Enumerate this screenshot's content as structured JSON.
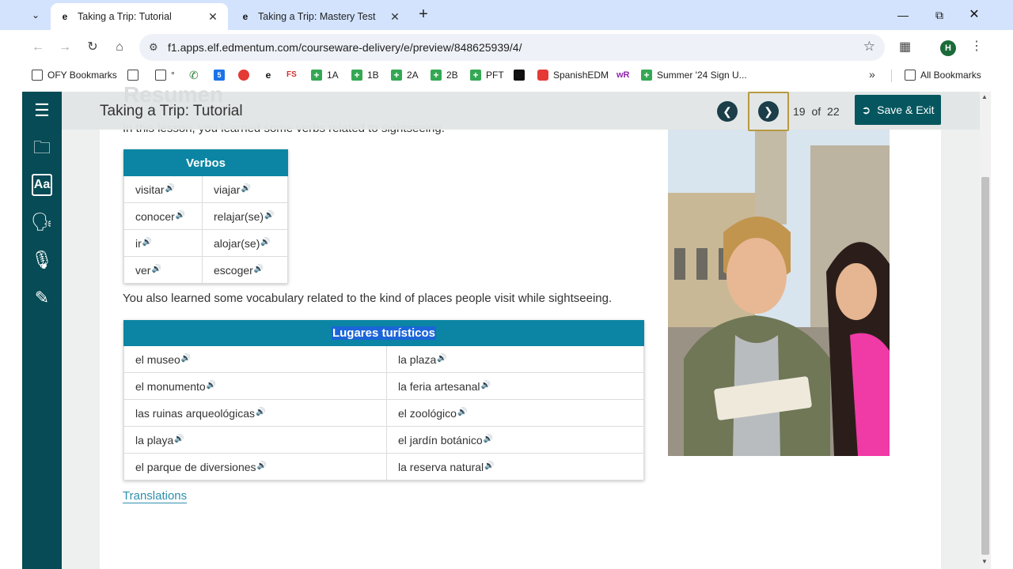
{
  "browser": {
    "tabs": [
      {
        "title": "Taking a Trip: Tutorial",
        "active": true
      },
      {
        "title": "Taking a Trip: Mastery Test",
        "active": false
      }
    ],
    "url": "f1.apps.elf.edmentum.com/courseware-delivery/e/preview/848625939/4/",
    "profile_initial": "H",
    "bookmarks": [
      {
        "label": "OFY Bookmarks",
        "icon": "bookmark-folder-icon"
      },
      {
        "label": "",
        "icon": "folder-icon"
      },
      {
        "label": "°",
        "icon": "folder-icon"
      },
      {
        "label": "",
        "icon": "phone-icon"
      },
      {
        "label": "",
        "icon": "calendar-icon"
      },
      {
        "label": "",
        "icon": "apple-icon"
      },
      {
        "label": "",
        "icon": "edmentum-icon"
      },
      {
        "label": "",
        "icon": "fs-icon"
      },
      {
        "label": "1A",
        "icon": "plus-green-icon"
      },
      {
        "label": "1B",
        "icon": "plus-green-icon"
      },
      {
        "label": "2A",
        "icon": "plus-green-icon"
      },
      {
        "label": "2B",
        "icon": "plus-green-icon"
      },
      {
        "label": "PFT",
        "icon": "plus-green-icon"
      },
      {
        "label": "",
        "icon": "black-icon"
      },
      {
        "label": "SpanishEDM",
        "icon": "youtube-icon"
      },
      {
        "label": "",
        "icon": "wr-icon"
      },
      {
        "label": "Summer '24 Sign U...",
        "icon": "plus-green-icon"
      }
    ],
    "all_bookmarks_label": "All Bookmarks"
  },
  "lesson": {
    "title": "Taking a Trip: Tutorial",
    "ghost_heading": "Resumen",
    "page_current": "19",
    "page_of": "of",
    "page_total": "22",
    "save_exit_label": "Save & Exit",
    "intro_text": "In this lesson, you learned some verbs related to sightseeing.",
    "verbos": {
      "header": "Verbos",
      "rows": [
        [
          "visitar",
          "viajar"
        ],
        [
          "conocer",
          "relajar(se)"
        ],
        [
          "ir",
          "alojar(se)"
        ],
        [
          "ver",
          "escoger"
        ]
      ]
    },
    "para2": "You also learned some vocabulary related to the kind of places people visit while sightseeing.",
    "lugares": {
      "header": "Lugares turísticos",
      "rows": [
        [
          "el museo",
          "la plaza"
        ],
        [
          "el monumento",
          "la feria artesanal"
        ],
        [
          "las ruinas arqueológicas",
          "el zoológico"
        ],
        [
          "la playa",
          "el jardín botánico"
        ],
        [
          "el parque de diversiones",
          "la reserva natural"
        ]
      ]
    },
    "translations_link": "Translations"
  },
  "sidebar": {
    "items": [
      "list-icon",
      "folder-icon",
      "dictionary-icon",
      "speech-icon",
      "microphone-icon",
      "highlighter-icon"
    ]
  },
  "colors": {
    "sidebar": "#064b55",
    "table_header": "#0b85a3",
    "save_button": "#05565e",
    "pager_button": "#1b3e49",
    "link": "#2f8fae"
  }
}
